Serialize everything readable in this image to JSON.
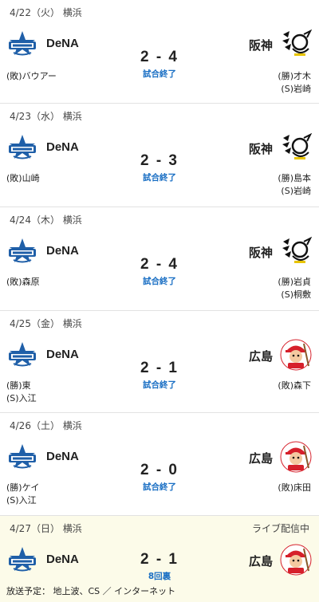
{
  "games": [
    {
      "date": "4/22（火）",
      "venue": "横浜",
      "away": {
        "name": "DeNA",
        "logo": "baystars-star-logo"
      },
      "home": {
        "name": "阪神",
        "logo": "tigers-tiger-logo"
      },
      "score": "2 - 4",
      "status": "試合終了",
      "away_pitchers": [
        "(敗)バウアー"
      ],
      "home_pitchers": [
        "(勝)才木",
        "(S)岩崎"
      ]
    },
    {
      "date": "4/23（水）",
      "venue": "横浜",
      "away": {
        "name": "DeNA",
        "logo": "baystars-star-logo"
      },
      "home": {
        "name": "阪神",
        "logo": "tigers-tiger-logo"
      },
      "score": "2 - 3",
      "status": "試合終了",
      "away_pitchers": [
        "(敗)山崎"
      ],
      "home_pitchers": [
        "(勝)島本",
        "(S)岩崎"
      ]
    },
    {
      "date": "4/24（木）",
      "venue": "横浜",
      "away": {
        "name": "DeNA",
        "logo": "baystars-star-logo"
      },
      "home": {
        "name": "阪神",
        "logo": "tigers-tiger-logo"
      },
      "score": "2 - 4",
      "status": "試合終了",
      "away_pitchers": [
        "(敗)森原"
      ],
      "home_pitchers": [
        "(勝)岩貞",
        "(S)桐敷"
      ]
    },
    {
      "date": "4/25（金）",
      "venue": "横浜",
      "away": {
        "name": "DeNA",
        "logo": "baystars-star-logo"
      },
      "home": {
        "name": "広島",
        "logo": "carp-mascot-logo"
      },
      "score": "2 - 1",
      "status": "試合終了",
      "away_pitchers": [
        "(勝)東",
        "(S)入江"
      ],
      "home_pitchers": [
        "(敗)森下"
      ]
    },
    {
      "date": "4/26（土）",
      "venue": "横浜",
      "away": {
        "name": "DeNA",
        "logo": "baystars-star-logo"
      },
      "home": {
        "name": "広島",
        "logo": "carp-mascot-logo"
      },
      "score": "2 - 0",
      "status": "試合終了",
      "away_pitchers": [
        "(勝)ケイ",
        "(S)入江"
      ],
      "home_pitchers": [
        "(敗)床田"
      ]
    },
    {
      "date": "4/27（日）",
      "venue": "横浜",
      "away": {
        "name": "DeNA",
        "logo": "baystars-star-logo"
      },
      "home": {
        "name": "広島",
        "logo": "carp-mascot-logo"
      },
      "score": "2 - 1",
      "status": "8回裏",
      "live_badge": "ライブ配信中",
      "broadcast": "放送予定：  地上波、CS ／ インターネット"
    }
  ],
  "colors": {
    "status_blue": "#1a6fc4",
    "baystars_blue": "#1f5fa8",
    "carp_red": "#d6202b",
    "live_bg": "#fcfbe9"
  }
}
